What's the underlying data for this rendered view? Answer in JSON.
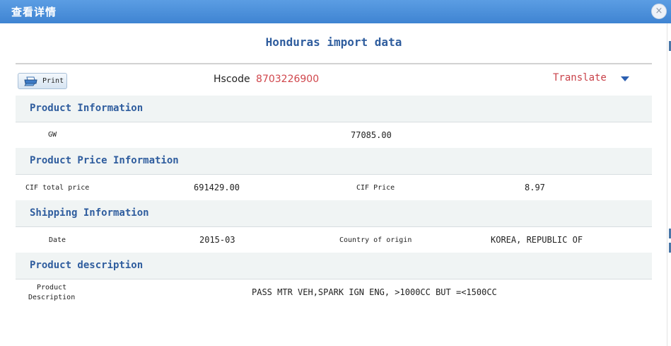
{
  "window": {
    "title": "查看详情",
    "close_symbol": "×"
  },
  "page": {
    "title": "Honduras import data"
  },
  "toolbar": {
    "print_label": "Print",
    "hscode_label": "Hscode",
    "hscode_value": "8703226900",
    "translate_label": "Translate"
  },
  "sections": {
    "product_info": {
      "header": "Product Information",
      "gw_label": "GW",
      "gw_value": "77085.00"
    },
    "price_info": {
      "header": "Product Price Information",
      "cif_total_label": "CIF total price",
      "cif_total_value": "691429.00",
      "cif_price_label": "CIF Price",
      "cif_price_value": "8.97"
    },
    "shipping_info": {
      "header": "Shipping Information",
      "date_label": "Date",
      "date_value": "2015-03",
      "origin_label": "Country of origin",
      "origin_value": "KOREA, REPUBLIC OF"
    },
    "description": {
      "header": "Product description",
      "label_line1": "Product",
      "label_line2": "Description",
      "value": "PASS MTR VEH,SPARK IGN ENG, >1000CC BUT =<1500CC"
    }
  },
  "colors": {
    "titlebar": "#4a90d9",
    "section_header_text": "#2f5d9e",
    "highlight_red": "#d0464c",
    "section_bg": "#f0f4f4"
  }
}
